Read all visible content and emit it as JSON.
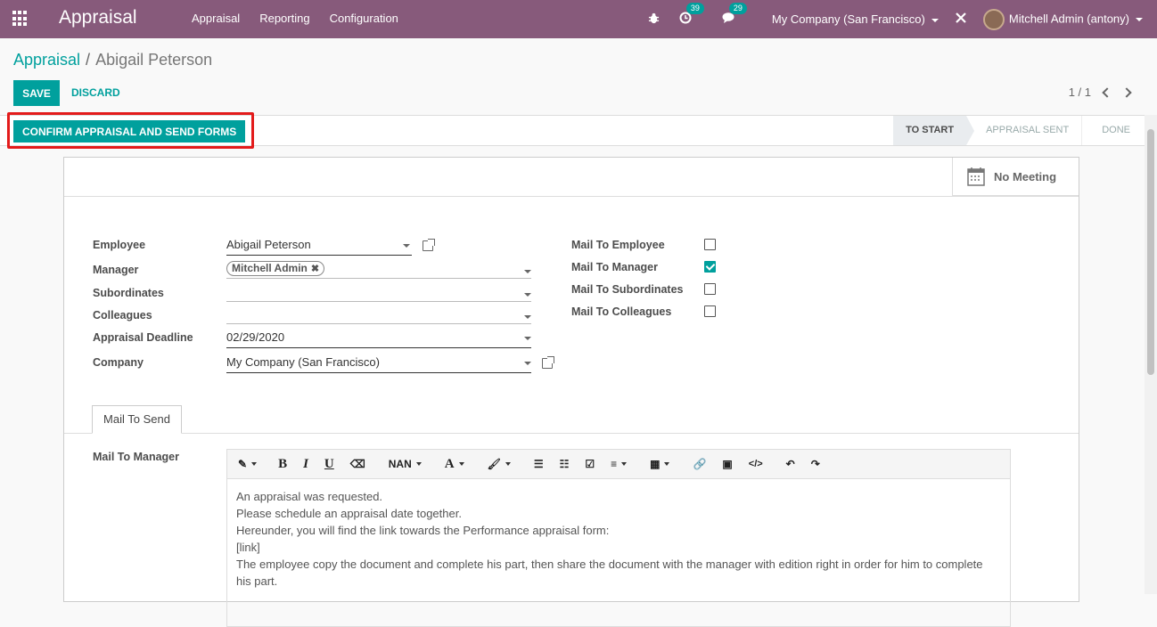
{
  "navbar": {
    "app_title": "Appraisal",
    "menu": [
      "Appraisal",
      "Reporting",
      "Configuration"
    ],
    "activity_count": "39",
    "messages_count": "29",
    "company": "My Company (San Francisco)",
    "user": "Mitchell Admin (antony)",
    "accent": "#875a7b"
  },
  "breadcrumb": {
    "parent": "Appraisal",
    "separator": "/",
    "current": "Abigail Peterson"
  },
  "actions": {
    "save": "SAVE",
    "discard": "DISCARD"
  },
  "pager": {
    "value": "1 / 1"
  },
  "statusbar": {
    "confirm_button": "CONFIRM APPRAISAL AND SEND FORMS",
    "stages": [
      "TO START",
      "APPRAISAL SENT",
      "DONE"
    ],
    "active_stage": "TO START"
  },
  "smart_button": {
    "label": "No Meeting"
  },
  "form": {
    "employee_label": "Employee",
    "employee_value": "Abigail Peterson",
    "manager_label": "Manager",
    "manager_tag": "Mitchell Admin",
    "subordinates_label": "Subordinates",
    "colleagues_label": "Colleagues",
    "deadline_label": "Appraisal Deadline",
    "deadline_value": "02/29/2020",
    "company_label": "Company",
    "company_value": "My Company (San Francisco)",
    "mail_employee_label": "Mail To Employee",
    "mail_manager_label": "Mail To Manager",
    "mail_subordinates_label": "Mail To Subordinates",
    "mail_colleagues_label": "Mail To Colleagues",
    "mail_employee": false,
    "mail_manager": true,
    "mail_subordinates": false,
    "mail_colleagues": false
  },
  "tab": {
    "label": "Mail To Send"
  },
  "mail_section": {
    "label": "Mail To Manager",
    "font_size_label": "NAN",
    "body": [
      "An appraisal was requested.",
      "Please schedule an appraisal date together.",
      "Hereunder, you will find the link towards the Performance appraisal form:",
      "[link]",
      "The employee copy the document and complete his part, then share the document with the manager with edition right in order for him to complete",
      "his part."
    ]
  }
}
